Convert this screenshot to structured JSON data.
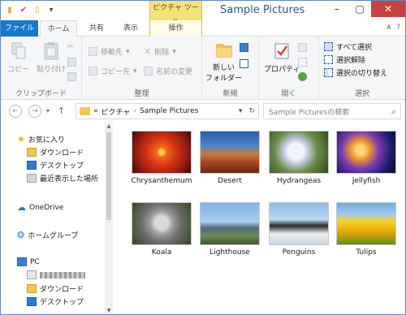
{
  "titlebar": {
    "title": "Sample Pictures",
    "context_tab": "ピクチャ ツール"
  },
  "tabs": {
    "file": "ファイル",
    "home": "ホーム",
    "share": "共有",
    "view": "表示",
    "manage": "操作"
  },
  "ribbon": {
    "clipboard": {
      "label": "クリップボード",
      "copy": "コピー",
      "paste": "貼り付け"
    },
    "organize": {
      "label": "整理",
      "move_to": "移動先",
      "copy_to": "コピー先",
      "delete": "削除",
      "rename": "名前の変更"
    },
    "new": {
      "label": "新規",
      "new_folder_line1": "新しい",
      "new_folder_line2": "フォルダー"
    },
    "open": {
      "label": "開く",
      "properties": "プロパティ"
    },
    "select": {
      "label": "選択",
      "select_all": "すべて選択",
      "select_none": "選択解除",
      "invert": "選択の切り替え"
    }
  },
  "address": {
    "crumb_prefix": "«",
    "crumb_1": "ピクチャ",
    "crumb_2": "Sample Pictures",
    "search_placeholder": "Sample Picturesの検索"
  },
  "navpane": {
    "favorites": "お気に入り",
    "downloads": "ダウンロード",
    "desktop": "デスクトップ",
    "recent": "最近表示した場所",
    "onedrive": "OneDrive",
    "homegroup": "ホームグループ",
    "pc": "PC",
    "pc_downloads": "ダウンロード",
    "pc_desktop": "デスクトップ"
  },
  "files": [
    {
      "name": "Chrysanthemum"
    },
    {
      "name": "Desert"
    },
    {
      "name": "Hydrangeas"
    },
    {
      "name": "Jellyfish"
    },
    {
      "name": "Koala"
    },
    {
      "name": "Lighthouse"
    },
    {
      "name": "Penguins"
    },
    {
      "name": "Tulips"
    }
  ],
  "colors": {
    "file_tab": "#1979ca",
    "context_tab": "#f6e27a",
    "close_button": "#c7423d",
    "title_text": "#2b579a"
  }
}
